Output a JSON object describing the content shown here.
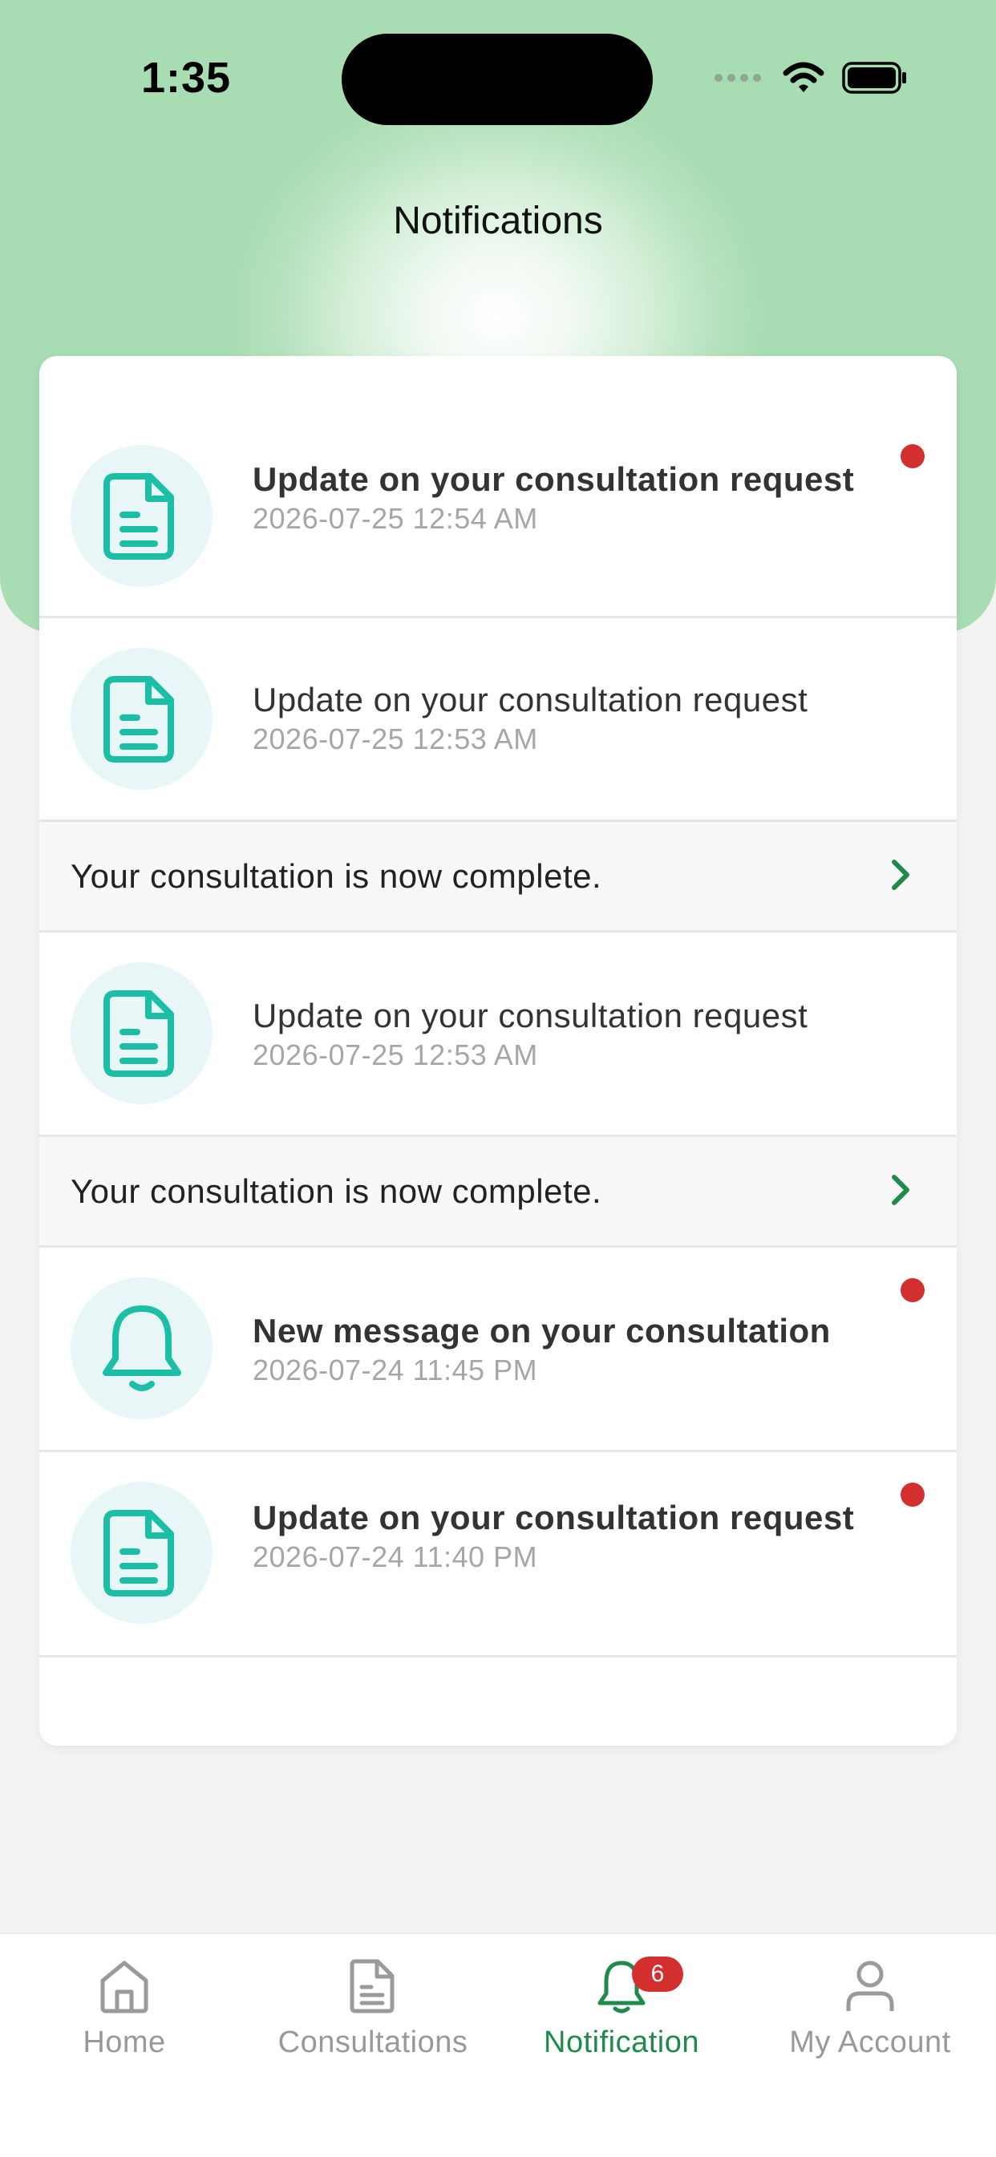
{
  "status_bar": {
    "time": "1:35"
  },
  "header": {
    "title": "Notifications"
  },
  "notifications": [
    {
      "title": "Update on your consultation request",
      "time": "2026-07-25 12:54 AM",
      "icon": "document-icon",
      "unread": true
    },
    {
      "title": "Update on your consultation request",
      "time": "2026-07-25 12:53 AM",
      "icon": "document-icon",
      "unread": false
    },
    {
      "title": "Update on your consultation request",
      "time": "2026-07-25 12:53 AM",
      "icon": "document-icon",
      "unread": false
    },
    {
      "title": "New message on your consultation",
      "time": "2026-07-24 11:45 PM",
      "icon": "bell-icon",
      "unread": true
    },
    {
      "title": "Update on your consultation request",
      "time": "2026-07-24 11:40 PM",
      "icon": "document-icon",
      "unread": true
    }
  ],
  "complete_rows": [
    {
      "text": "Your consultation is now complete."
    },
    {
      "text": "Your consultation is now complete."
    }
  ],
  "tabbar": {
    "tabs": [
      {
        "label": "Home",
        "icon": "home-icon",
        "active": false
      },
      {
        "label": "Consultations",
        "icon": "document-icon",
        "active": false
      },
      {
        "label": "Notification",
        "icon": "bell-icon",
        "active": true,
        "badge": "6"
      },
      {
        "label": "My Account",
        "icon": "person-icon",
        "active": false
      }
    ]
  },
  "colors": {
    "accent_green": "#1f8a4c",
    "teal_icon": "#1bbfa5",
    "unread_dot": "#d32f2f",
    "header_gradient": "#a8dcb2"
  }
}
